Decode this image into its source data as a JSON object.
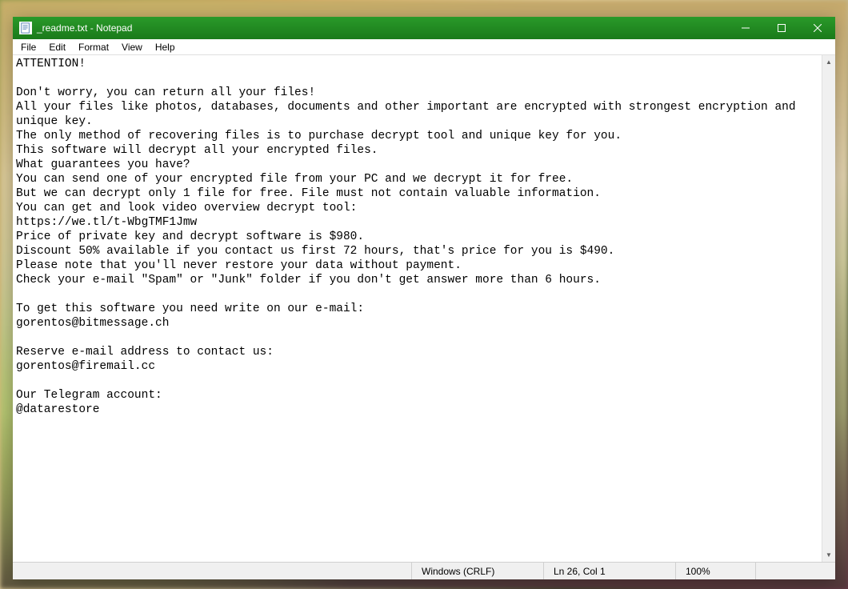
{
  "window": {
    "title": "_readme.txt - Notepad"
  },
  "menubar": {
    "file": "File",
    "edit": "Edit",
    "format": "Format",
    "view": "View",
    "help": "Help"
  },
  "editor": {
    "content": "ATTENTION!\n\nDon't worry, you can return all your files!\nAll your files like photos, databases, documents and other important are encrypted with strongest encryption and unique key.\nThe only method of recovering files is to purchase decrypt tool and unique key for you.\nThis software will decrypt all your encrypted files.\nWhat guarantees you have?\nYou can send one of your encrypted file from your PC and we decrypt it for free.\nBut we can decrypt only 1 file for free. File must not contain valuable information.\nYou can get and look video overview decrypt tool:\nhttps://we.tl/t-WbgTMF1Jmw\nPrice of private key and decrypt software is $980.\nDiscount 50% available if you contact us first 72 hours, that's price for you is $490.\nPlease note that you'll never restore your data without payment.\nCheck your e-mail \"Spam\" or \"Junk\" folder if you don't get answer more than 6 hours.\n\nTo get this software you need write on our e-mail:\ngorentos@bitmessage.ch\n\nReserve e-mail address to contact us:\ngorentos@firemail.cc\n\nOur Telegram account:\n@datarestore"
  },
  "statusbar": {
    "encoding": "Windows (CRLF)",
    "position": "Ln 26, Col 1",
    "zoom": "100%"
  }
}
